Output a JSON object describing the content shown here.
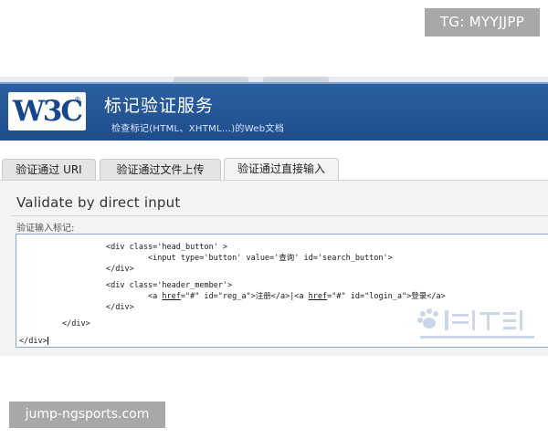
{
  "badges": {
    "telegram": "TG: MYYJJPP",
    "site": "jump-ngsports.com"
  },
  "header": {
    "logo_text": "W3C",
    "logo_reg": "®",
    "title": "标记验证服务",
    "subtitle": "检查标记(HTML、XHTML…)的Web文档"
  },
  "tabs": [
    {
      "label": "验证通过 URI",
      "active": false
    },
    {
      "label": "验证通过文件上传",
      "active": false
    },
    {
      "label": "验证通过直接输入",
      "active": true
    }
  ],
  "panel": {
    "heading": "Validate by direct input",
    "field_label": "验证输入标记:"
  },
  "code_lines": [
    {
      "parts": [
        {
          "t": "<div class='head_button' >"
        }
      ]
    },
    {
      "parts": [
        {
          "t": "<input type='button' value='查询' id='search_button'>"
        }
      ]
    },
    {
      "parts": [
        {
          "t": "</div>"
        }
      ]
    },
    {
      "parts": [
        {
          "t": "<div class='header_member'>"
        }
      ]
    },
    {
      "parts": [
        {
          "t": "<a "
        },
        {
          "t": "href",
          "u": true
        },
        {
          "t": "=\"#\" id=\"reg_a\">注册</a>|<a "
        },
        {
          "t": "href",
          "u": true
        },
        {
          "t": "=\"#\" id=\"login_a\">登录</a>"
        }
      ]
    },
    {
      "parts": [
        {
          "t": "</div>"
        }
      ]
    },
    {
      "parts": [
        {
          "t": "</div>"
        }
      ]
    },
    {
      "parts": [
        {
          "t": "</div>"
        }
      ]
    }
  ],
  "colors": {
    "header_blue": "#1f4d8c",
    "logo_blue": "#17468b",
    "panel_bg": "#f3f3f3",
    "textarea_border": "#8aa6c9"
  },
  "icons": {
    "watermark": "baidu-jingyan-watermark-icon"
  }
}
